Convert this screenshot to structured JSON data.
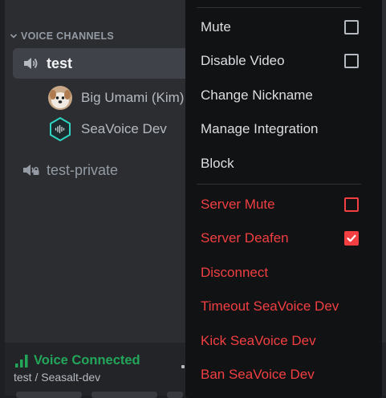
{
  "sidebar": {
    "category": "VOICE CHANNELS",
    "channels": [
      {
        "name": "test",
        "active": true,
        "members": [
          {
            "name": "Big Umami (Kim)",
            "avatar": "dog-avatar"
          },
          {
            "name": "SeaVoice Dev",
            "avatar": "waveform-avatar"
          }
        ]
      },
      {
        "name": "test-private",
        "active": false,
        "locked": true
      }
    ]
  },
  "voice_status": {
    "label": "Voice Connected",
    "subtitle": "test / Seasalt-dev",
    "color": "#23a55a"
  },
  "context_menu": {
    "items": [
      {
        "label": "Mute",
        "checkbox": "unchecked",
        "danger": false
      },
      {
        "label": "Disable Video",
        "checkbox": "unchecked",
        "danger": false
      },
      {
        "label": "Change Nickname",
        "danger": false
      },
      {
        "label": "Manage Integration",
        "danger": false
      },
      {
        "label": "Block",
        "danger": false
      },
      {
        "label": "Server Mute",
        "checkbox": "unchecked",
        "danger": true
      },
      {
        "label": "Server Deafen",
        "checkbox": "checked",
        "danger": true
      },
      {
        "label": "Disconnect",
        "danger": true
      },
      {
        "label": "Timeout SeaVoice Dev",
        "danger": true
      },
      {
        "label": "Kick SeaVoice Dev",
        "danger": true
      },
      {
        "label": "Ban SeaVoice Dev",
        "danger": true
      }
    ],
    "danger_color": "#f23f42"
  }
}
